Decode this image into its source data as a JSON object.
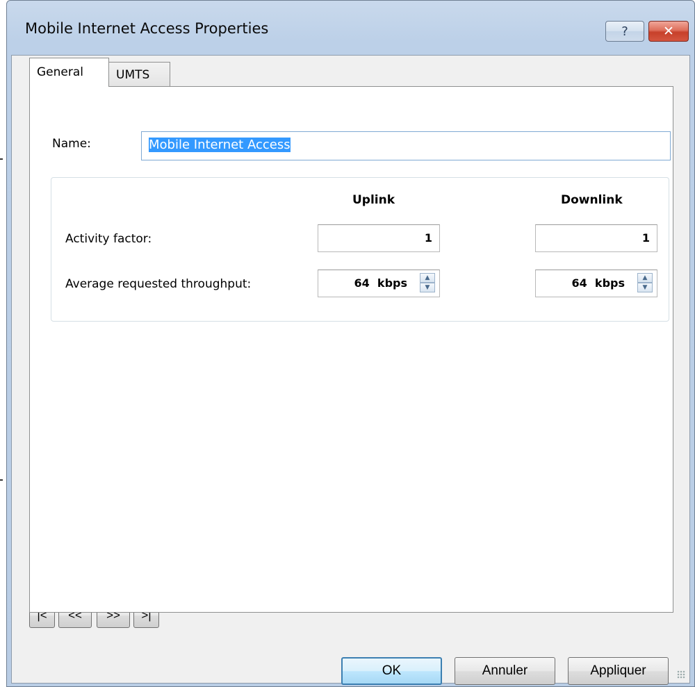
{
  "window": {
    "title": "Mobile Internet Access Properties",
    "help_glyph": "?",
    "close_glyph": "✕"
  },
  "tabs": [
    {
      "label": "General",
      "selected": true
    },
    {
      "label": "UMTS",
      "selected": false
    }
  ],
  "general": {
    "name_label": "Name:",
    "name_value": "Mobile Internet Access",
    "columns": {
      "uplink": "Uplink",
      "downlink": "Downlink"
    },
    "rows": {
      "activity_factor": {
        "label": "Activity factor:",
        "uplink": "1",
        "downlink": "1"
      },
      "avg_throughput": {
        "label": "Average requested throughput:",
        "uplink_value": "64",
        "downlink_value": "64",
        "unit": "kbps"
      }
    }
  },
  "navigation": {
    "first": "|<",
    "prev": "<<",
    "next": ">>",
    "last": ">|"
  },
  "buttons": {
    "ok": "OK",
    "cancel": "Annuler",
    "apply": "Appliquer"
  },
  "icons": {
    "spin_up": "▲",
    "spin_down": "▼"
  }
}
